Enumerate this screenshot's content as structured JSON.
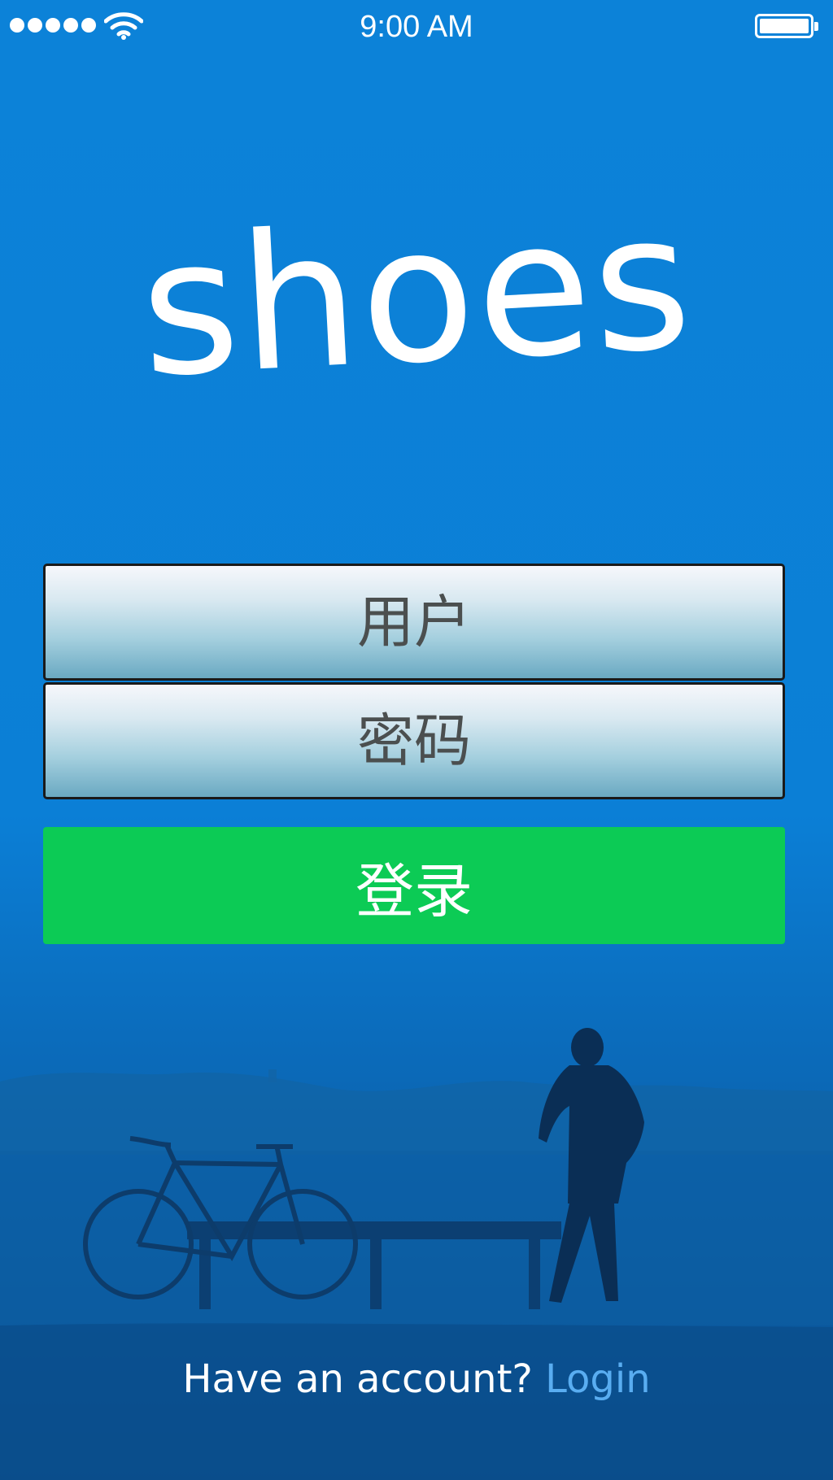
{
  "status_bar": {
    "time": "9:00 AM",
    "signal_icon": "signal-dots-icon",
    "wifi_icon": "wifi-icon",
    "battery_icon": "battery-icon",
    "battery_level": 1.0
  },
  "app": {
    "logo_text": "shoes"
  },
  "form": {
    "username_placeholder": "用户",
    "password_placeholder": "密码",
    "login_button_label": "登录"
  },
  "footer": {
    "prompt": "Have an account?",
    "login_link": "Login"
  },
  "colors": {
    "background": "#0c82d8",
    "login_button": "#0ccb55",
    "link": "#59adf1"
  }
}
